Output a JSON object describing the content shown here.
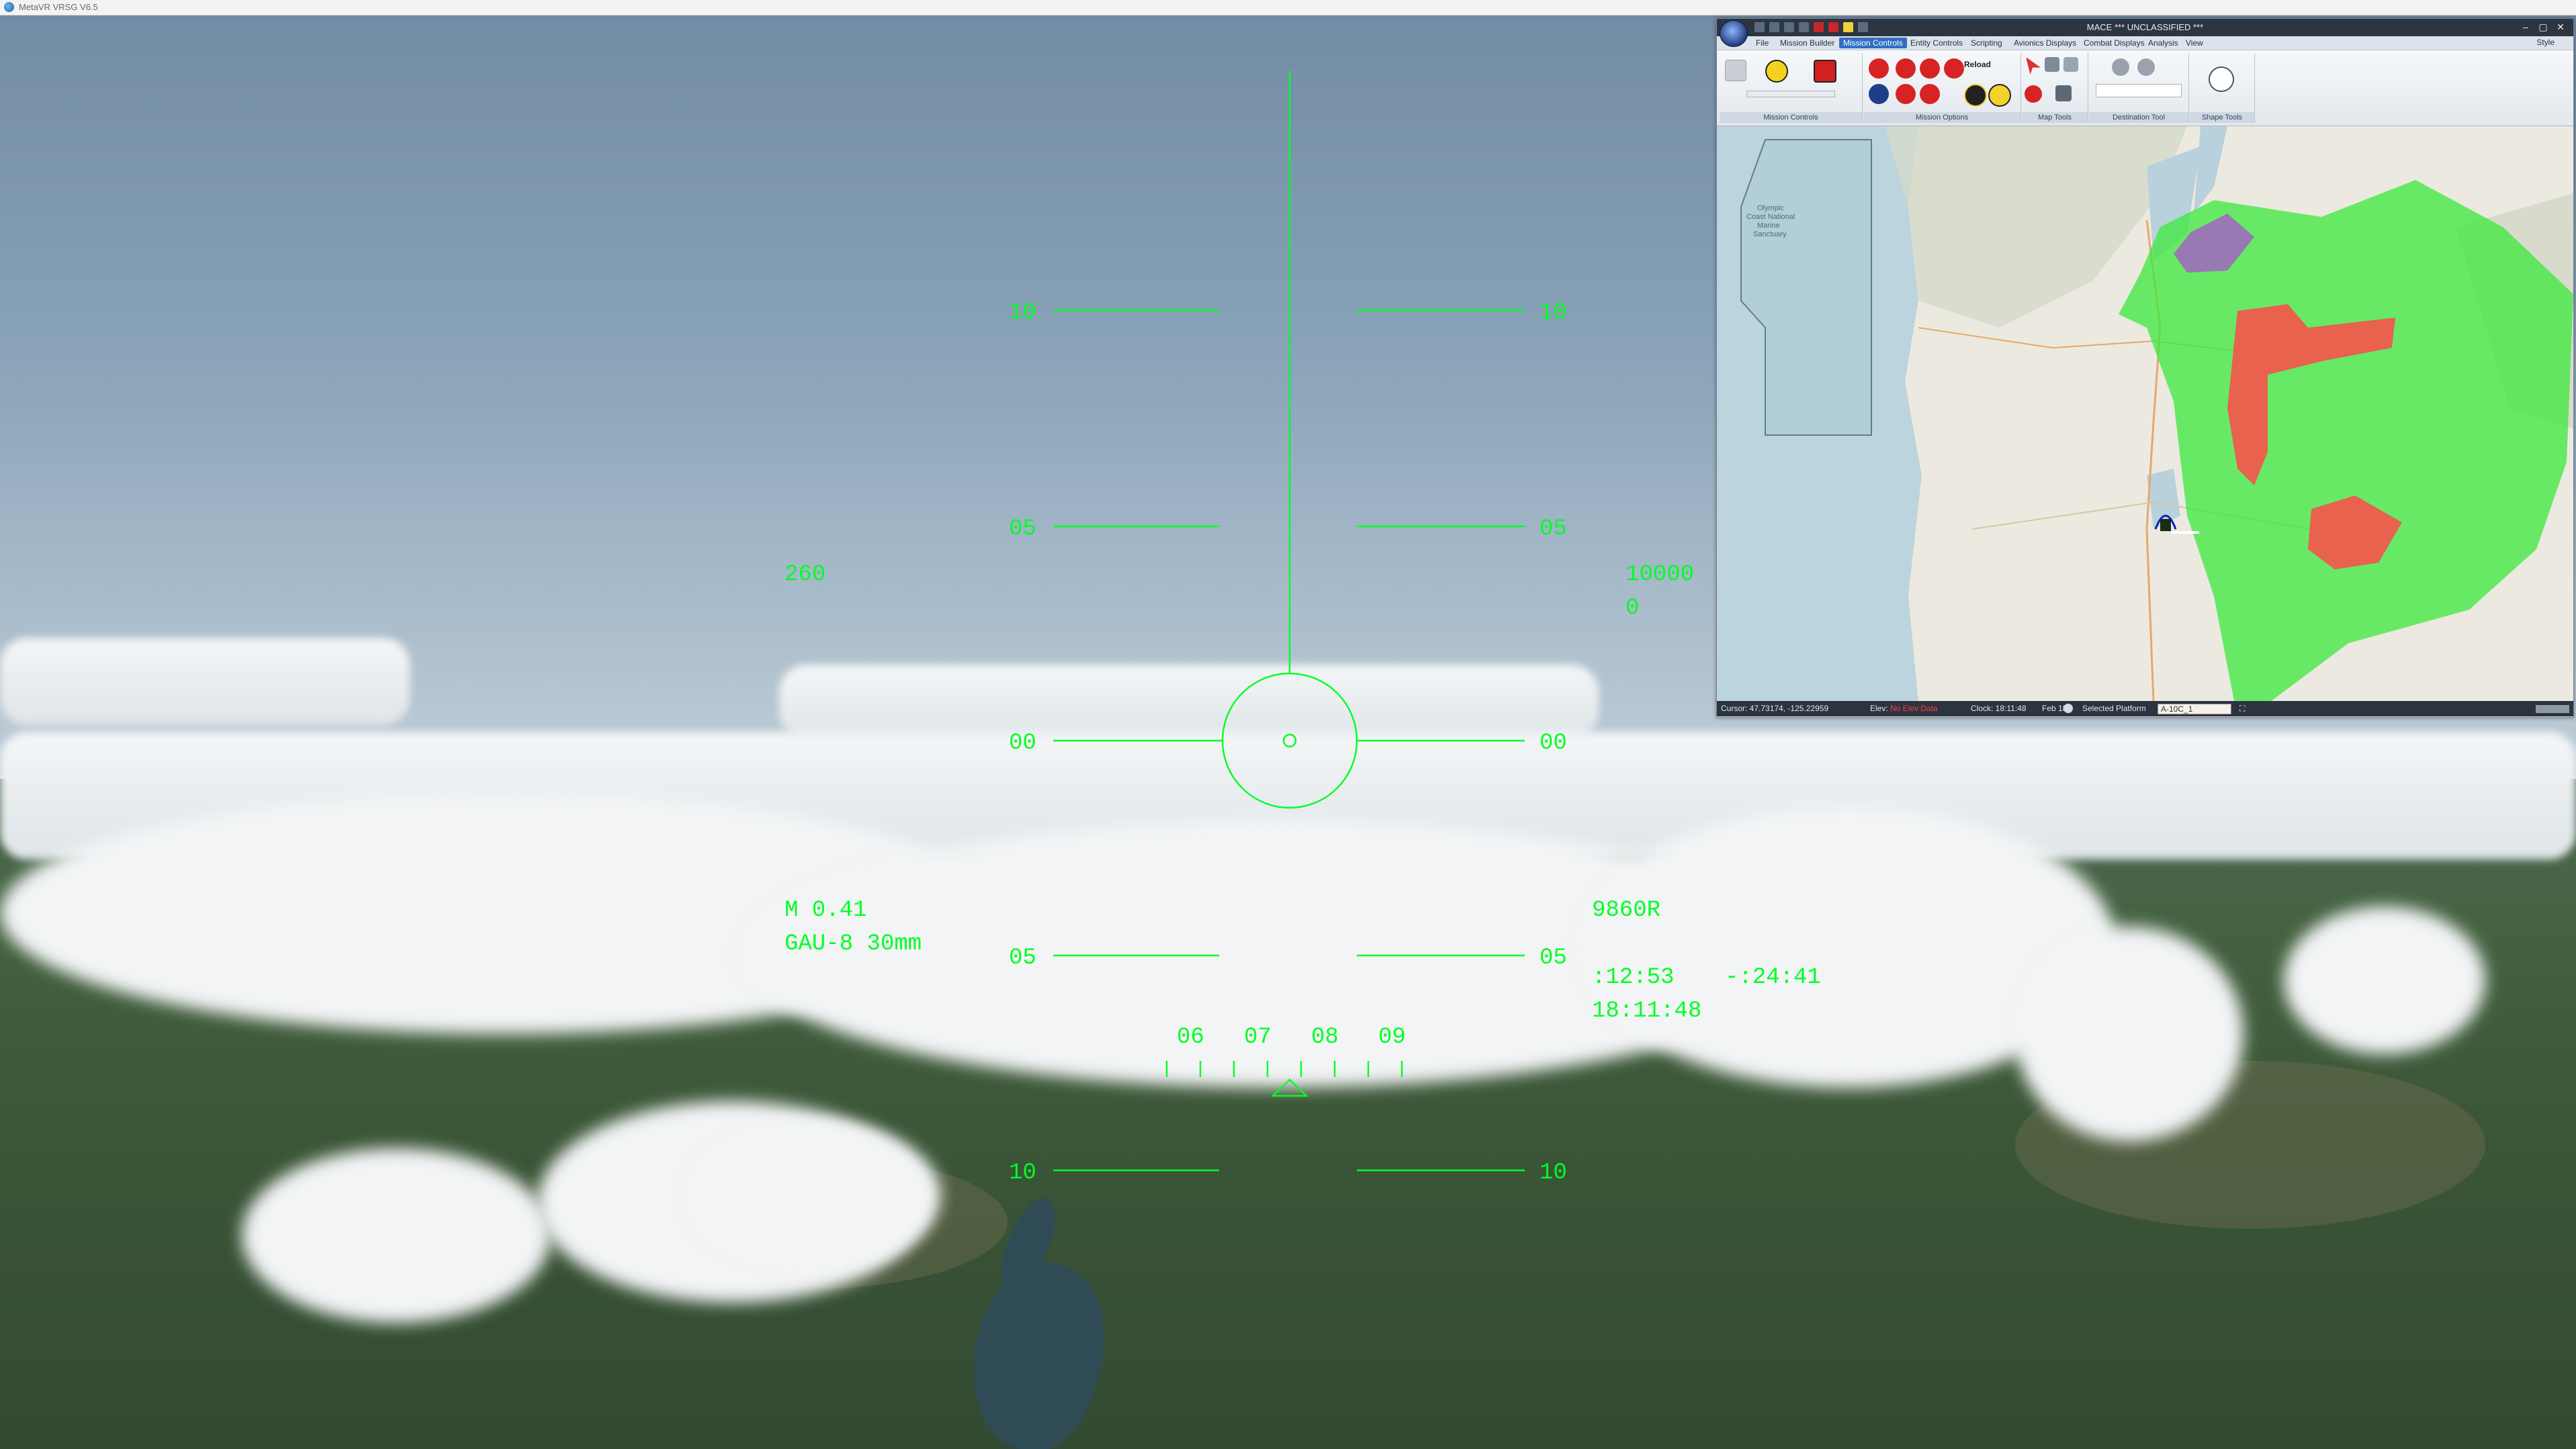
{
  "window": {
    "title": "MetaVR VRSG V6.5"
  },
  "hud": {
    "pitch_ladder": {
      "upper_10": "10",
      "upper_05": "05",
      "horizon": "00",
      "lower_05": "05",
      "lower_10": "10"
    },
    "airspeed": "260",
    "altitude": "10000",
    "vertical_speed": "0",
    "mach": "M 0.41",
    "weapon": "GAU-8 30mm",
    "radar_altitude": "9860R",
    "elapsed_time": ":12:53",
    "remaining_time": "-:24:41",
    "clock": "18:11:48",
    "heading_tape": [
      "06",
      "07",
      "08",
      "09"
    ]
  },
  "mace": {
    "title": "MACE *** UNCLASSIFIED ***",
    "menu": [
      {
        "label": "File",
        "active": false
      },
      {
        "label": "Mission Builder",
        "active": false
      },
      {
        "label": "Mission Controls",
        "active": true
      },
      {
        "label": "Entity Controls",
        "active": false
      },
      {
        "label": "Scripting",
        "active": false
      },
      {
        "label": "Avionics Displays",
        "active": false
      },
      {
        "label": "Combat Displays",
        "active": false
      },
      {
        "label": "Analysis",
        "active": false
      },
      {
        "label": "View",
        "active": false
      }
    ],
    "style_label": "Style",
    "ribbon_groups": {
      "mission_controls": "Mission Controls",
      "mission_options": "Mission Options",
      "map_tools": "Map Tools",
      "destination_tool": "Destination Tool",
      "shape_tools": "Shape Tools"
    },
    "ribbon_reload": "Reload",
    "map": {
      "label": "Olympic Coast National Marine Sanctuary",
      "label_lines": [
        "Olympic",
        "Coast National",
        "Marine",
        "Sanctuary"
      ],
      "zone_colors": {
        "coverage": "#3ce83c",
        "threat": "#ff4a4a",
        "restricted": "#a45cc8"
      }
    },
    "status": {
      "cursor": "Cursor: 47.73174, -125.22959",
      "elev_label": "Elev:",
      "elev_value": "No Elev Data",
      "clock": "Clock: 18:11:48",
      "date": "Feb 18",
      "selected_platform": "Selected Platform",
      "platform_value": "A-10C_1"
    }
  }
}
